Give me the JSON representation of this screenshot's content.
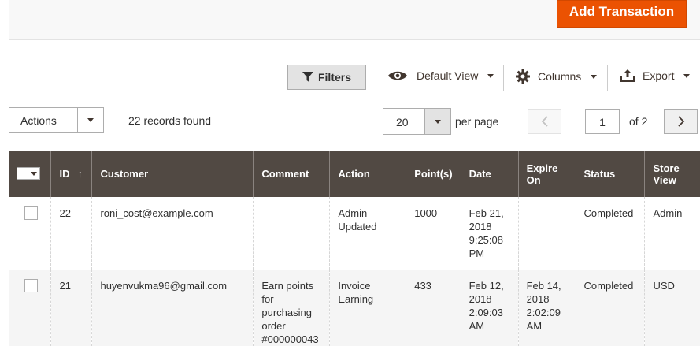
{
  "header": {
    "add_button": "Add Transaction"
  },
  "toolbar": {
    "filters": "Filters",
    "default_view": "Default View",
    "columns": "Columns",
    "export": "Export"
  },
  "grid_controls": {
    "actions": "Actions",
    "records_found": "22 records found",
    "per_page_value": "20",
    "per_page_label": "per page",
    "current_page": "1",
    "of_pages": "of 2"
  },
  "table": {
    "columns": [
      "ID",
      "Customer",
      "Comment",
      "Action",
      "Point(s)",
      "Date",
      "Expire On",
      "Status",
      "Store View"
    ],
    "sort_indicator": "↑",
    "rows": [
      {
        "id": "22",
        "customer": "roni_cost@example.com",
        "comment": "",
        "action": "Admin Updated",
        "points": "1000",
        "date": "Feb 21, 2018 9:25:08 PM",
        "expire": "",
        "status": "Completed",
        "store": "Admin"
      },
      {
        "id": "21",
        "customer": "huyenvukma96@gmail.com",
        "comment": "Earn points for purchasing order #000000043",
        "action": "Invoice Earning",
        "points": "433",
        "date": "Feb 12, 2018 2:09:03 AM",
        "expire": "Feb 14, 2018 2:02:09 AM",
        "status": "Completed",
        "store": "USD"
      }
    ]
  }
}
